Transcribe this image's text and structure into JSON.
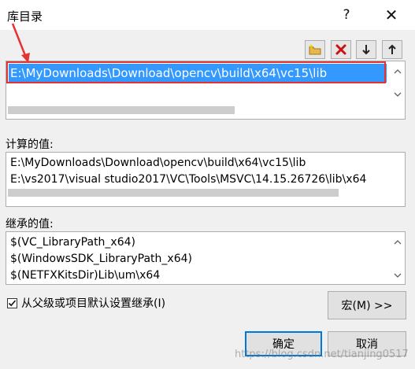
{
  "window": {
    "title": "库目录",
    "help_label": "?",
    "close_label": "✕"
  },
  "toolbar": {
    "new_line_icon": "new-folder-icon",
    "delete_icon": "delete-x-icon",
    "move_down_icon": "arrow-down-icon",
    "move_up_icon": "arrow-up-icon"
  },
  "directories": {
    "selected_entry": "E:\\MyDownloads\\Download\\opencv\\build\\x64\\vc15\\lib"
  },
  "evaluated": {
    "label": "计算的值:",
    "lines": [
      "E:\\MyDownloads\\Download\\opencv\\build\\x64\\vc15\\lib",
      "E:\\vs2017\\visual studio2017\\VC\\Tools\\MSVC\\14.15.26726\\lib\\x64"
    ]
  },
  "inherited": {
    "label": "继承的值:",
    "lines": [
      "$(VC_LibraryPath_x64)",
      "$(WindowsSDK_LibraryPath_x64)",
      "$(NETFXKitsDir)Lib\\um\\x64"
    ]
  },
  "inherit_checkbox": {
    "label": "从父级或项目默认设置继承(I)",
    "checked": true
  },
  "buttons": {
    "macros": "宏(M) >>",
    "ok": "确定",
    "cancel": "取消"
  },
  "watermark": "https://blog.csdn.net/tianjing0517",
  "colors": {
    "selection": "#3399ff",
    "highlight_box": "#e53333",
    "default_button_border": "#0078d7"
  }
}
